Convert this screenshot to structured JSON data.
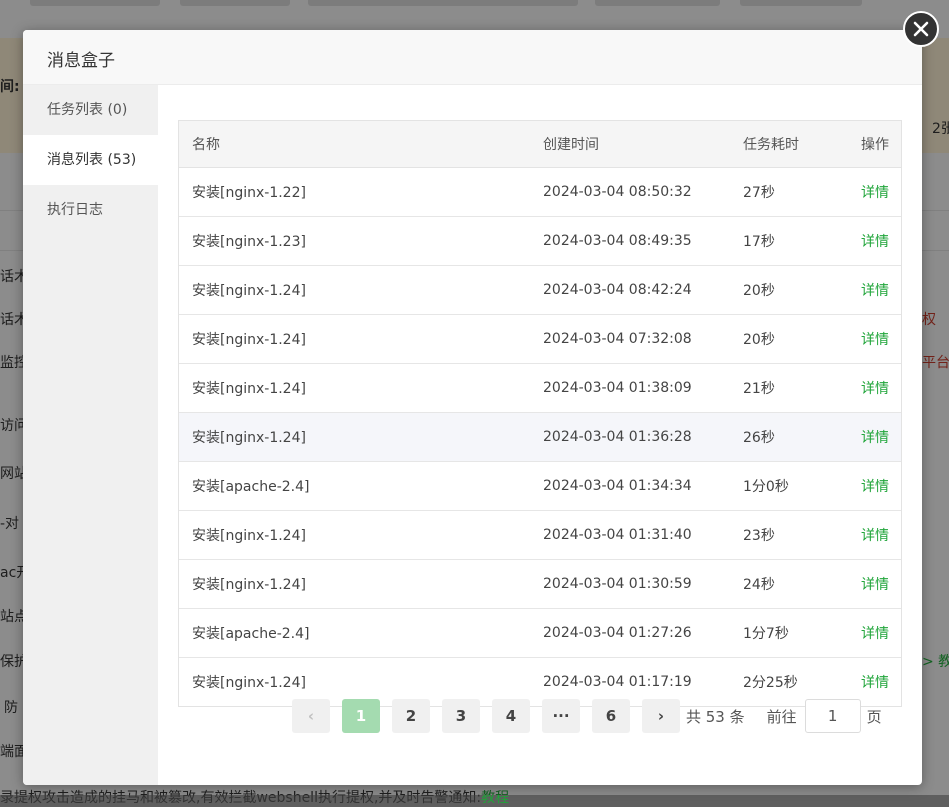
{
  "modal": {
    "title": "消息盒子",
    "sidebar": [
      {
        "label": "任务列表 (0)",
        "active": false
      },
      {
        "label": "消息列表 (53)",
        "active": true
      },
      {
        "label": "执行日志",
        "active": false
      }
    ],
    "table": {
      "headers": [
        "名称",
        "创建时间",
        "任务耗时",
        "操作"
      ],
      "rows": [
        {
          "name": "安装[nginx-1.22]",
          "time": "2024-03-04 08:50:32",
          "duration": "27秒",
          "action": "详情"
        },
        {
          "name": "安装[nginx-1.23]",
          "time": "2024-03-04 08:49:35",
          "duration": "17秒",
          "action": "详情"
        },
        {
          "name": "安装[nginx-1.24]",
          "time": "2024-03-04 08:42:24",
          "duration": "20秒",
          "action": "详情"
        },
        {
          "name": "安装[nginx-1.24]",
          "time": "2024-03-04 07:32:08",
          "duration": "20秒",
          "action": "详情"
        },
        {
          "name": "安装[nginx-1.24]",
          "time": "2024-03-04 01:38:09",
          "duration": "21秒",
          "action": "详情"
        },
        {
          "name": "安装[nginx-1.24]",
          "time": "2024-03-04 01:36:28",
          "duration": "26秒",
          "action": "详情"
        },
        {
          "name": "安装[apache-2.4]",
          "time": "2024-03-04 01:34:34",
          "duration": "1分0秒",
          "action": "详情"
        },
        {
          "name": "安装[nginx-1.24]",
          "time": "2024-03-04 01:31:40",
          "duration": "23秒",
          "action": "详情"
        },
        {
          "name": "安装[nginx-1.24]",
          "time": "2024-03-04 01:30:59",
          "duration": "24秒",
          "action": "详情"
        },
        {
          "name": "安装[apache-2.4]",
          "time": "2024-03-04 01:27:26",
          "duration": "1分7秒",
          "action": "详情"
        },
        {
          "name": "安装[nginx-1.24]",
          "time": "2024-03-04 01:17:19",
          "duration": "2分25秒",
          "action": "详情"
        }
      ]
    },
    "pagination": {
      "prev": "‹",
      "pages": [
        "1",
        "2",
        "3",
        "4",
        "···",
        "6"
      ],
      "current": "1",
      "next": "›",
      "total": "共 53 条",
      "goto_label": "前往",
      "goto_value": "1",
      "page_unit": "页"
    }
  },
  "background": {
    "left_fragments": [
      "间:",
      "话术",
      "话术",
      "监控",
      "访问",
      "网站",
      "-对",
      "ac开",
      "站点",
      "保护",
      "防",
      "端面"
    ],
    "right_fragments": [
      "2张",
      "权",
      "平台",
      "> 教"
    ],
    "bottom_text": "录提权攻击造成的挂马和被篡改,有效拦截webshell执行提权,并及时告警通知:",
    "bottom_link": "教程"
  },
  "colors": {
    "accent": "#20a53a",
    "active_page": "#a4dbb0"
  },
  "icons": {
    "close": "close-icon"
  }
}
